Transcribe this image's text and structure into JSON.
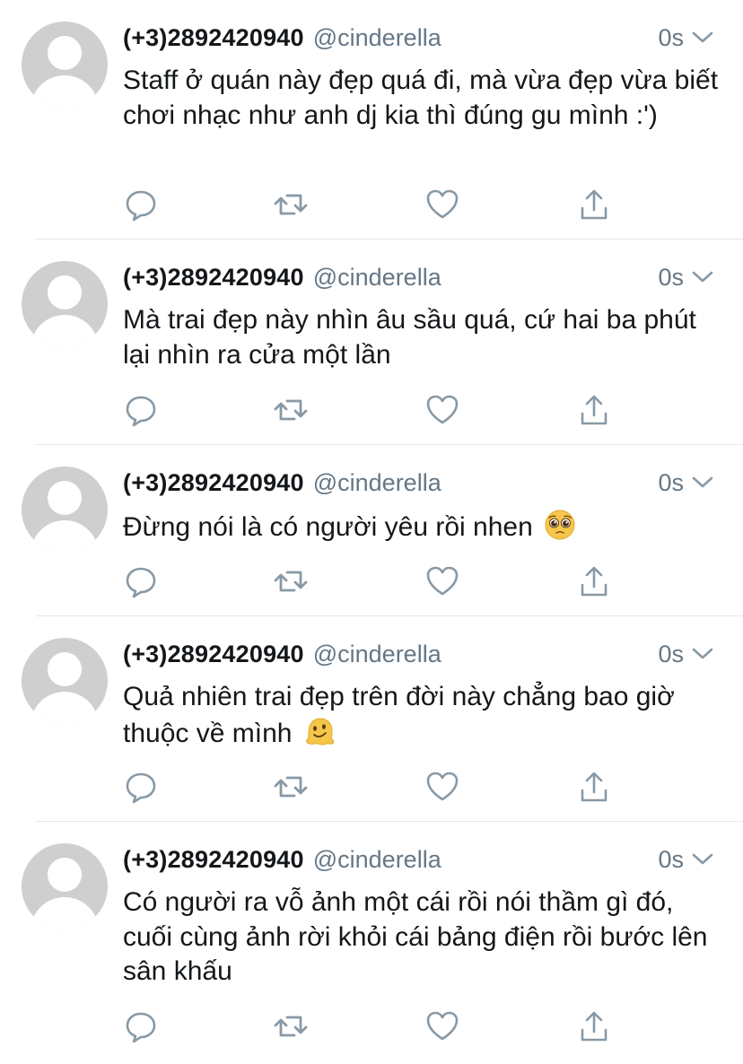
{
  "tweets": [
    {
      "name": "(+3)2892420940",
      "handle": "@cinderella",
      "time": "0s",
      "text": "Staff ở quán này đẹp quá đi, mà vừa đẹp vừa biết chơi nhạc như anh dj kia thì đúng gu mình :')",
      "emoji": null
    },
    {
      "name": "(+3)2892420940",
      "handle": "@cinderella",
      "time": "0s",
      "text": "Mà trai đẹp này nhìn âu sầu quá, cứ hai ba phút lại nhìn ra cửa một lần",
      "emoji": null
    },
    {
      "name": "(+3)2892420940",
      "handle": "@cinderella",
      "time": "0s",
      "text": "Đừng nói là có người yêu rồi nhen",
      "emoji": "pleading-face-emoji"
    },
    {
      "name": "(+3)2892420940",
      "handle": "@cinderella",
      "time": "0s",
      "text": "Quả nhiên trai đẹp trên đời này chẳng bao giờ thuộc về mình",
      "emoji": "melting-face-emoji"
    },
    {
      "name": "(+3)2892420940",
      "handle": "@cinderella",
      "time": "0s",
      "text": "Có người ra vỗ ảnh một cái rồi nói thầm gì đó, cuối cùng ảnh rời khỏi cái bảng điện rồi bước lên sân khấu",
      "emoji": null
    }
  ],
  "icons": {
    "reply": "reply-icon",
    "retweet": "retweet-icon",
    "like": "heart-icon",
    "share": "share-icon",
    "menu": "chevron-down-icon"
  },
  "colors": {
    "text": "#14171a",
    "secondary": "#657786",
    "icon": "#8899a6",
    "divider": "#e1e8ed",
    "avatar": "#cfcfcf"
  }
}
